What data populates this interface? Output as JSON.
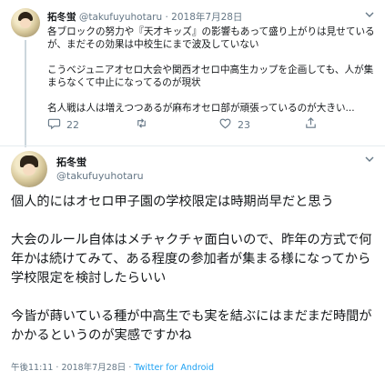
{
  "reply_tweet": {
    "display_name": "拓冬蛍",
    "handle": "@takufuyuhotaru",
    "separator": "·",
    "date": "2018年7月28日",
    "paragraphs": [
      "各ブロックの努力や『天才キッズ』の影響もあって盛り上がりは見せているが、まだその効果は中校生にまで波及していない",
      "こうべジュニアオセロ大会や関西オセロ中高生カップを企画しても、人が集まらなくて中止になってるのが現状",
      "名人戦は人は増えつつあるが麻布オセロ部が頑張っているのが大きい..."
    ],
    "actions": {
      "reply_count": "22",
      "retweet_count": "",
      "like_count": "23",
      "share_label": ""
    }
  },
  "main_tweet": {
    "display_name": "拓冬蛍",
    "handle": "@takufuyuhotaru",
    "paragraphs": [
      "個人的にはオセロ甲子園の学校限定は時期尚早だと思う",
      "大会のルール自体はメチャクチャ面白いので、昨年の方式で何年かは続けてみて、ある程度の参加者が集まる様になってから学校限定を検討したらいい",
      "今皆が蒔いている種が中高生でも実を結ぶにはまだまだ時間がかかるというのが実感ですかね"
    ],
    "time": "午後11:11",
    "separator": "·",
    "date": "2018年7月28日",
    "source": "Twitter for Android"
  },
  "colors": {
    "text": "#14171a",
    "secondary": "#657786",
    "divider": "#e6ecf0",
    "link": "#1da1f2"
  },
  "icons": [
    "avatar",
    "chevron-down-icon",
    "reply-icon",
    "retweet-icon",
    "like-icon",
    "share-icon"
  ]
}
